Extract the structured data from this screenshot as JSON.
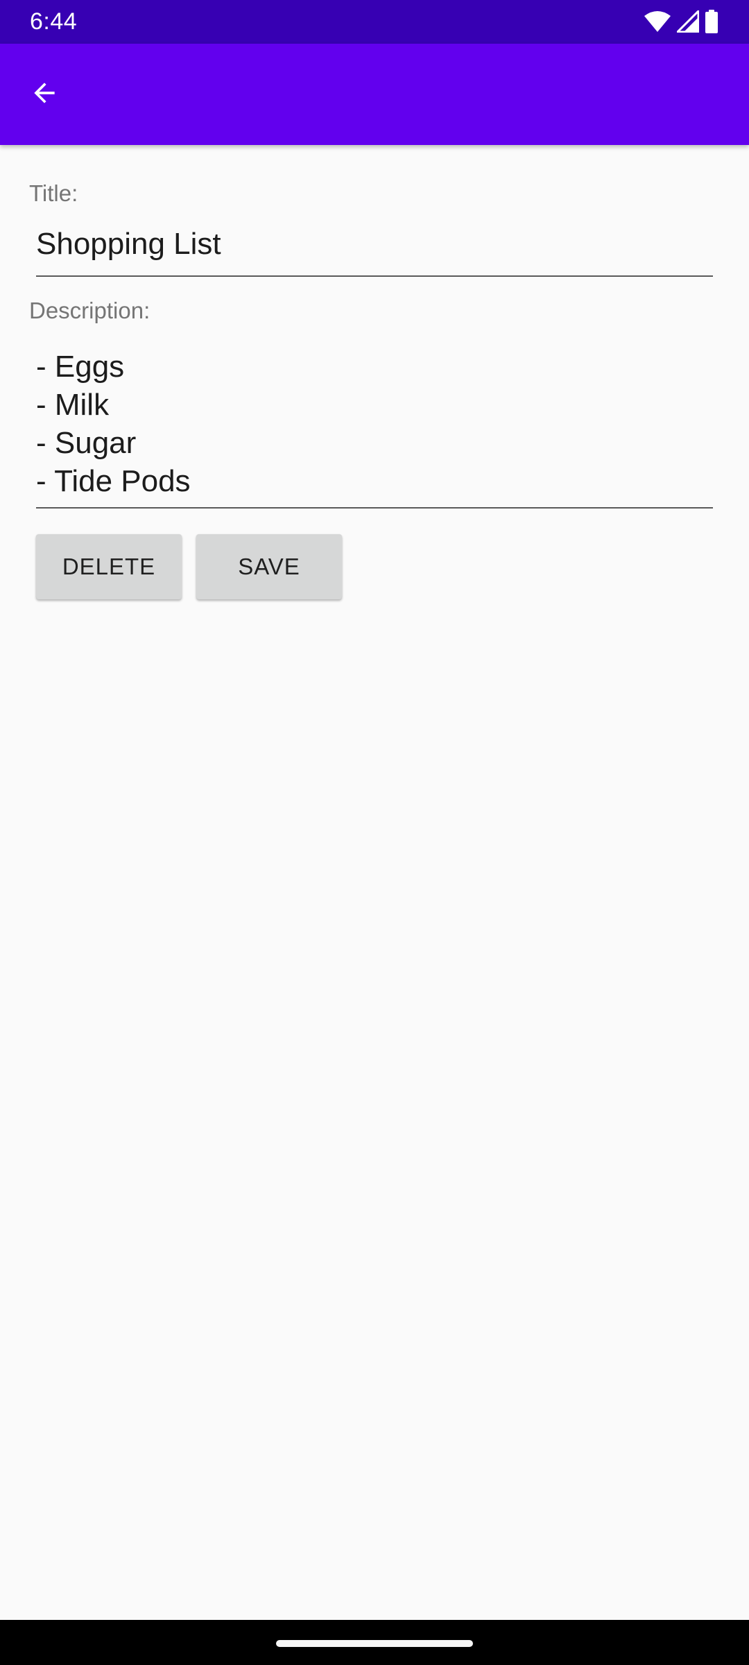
{
  "status_bar": {
    "time": "6:44",
    "icons": [
      "wifi-icon",
      "signal-icon",
      "battery-icon"
    ]
  },
  "app_bar": {
    "back_icon": "arrow-back-icon",
    "color": "#6200ee"
  },
  "form": {
    "title_label": "Title:",
    "title_value": "Shopping List",
    "description_label": "Description:",
    "description_lines": [
      "- Eggs",
      "- Milk",
      "- Sugar",
      "- Tide Pods"
    ]
  },
  "buttons": {
    "delete_label": "DELETE",
    "save_label": "SAVE"
  },
  "colors": {
    "status_bar": "#3700b3",
    "app_bar": "#6200ee",
    "background": "#fafafa",
    "button": "#d6d7d7"
  }
}
